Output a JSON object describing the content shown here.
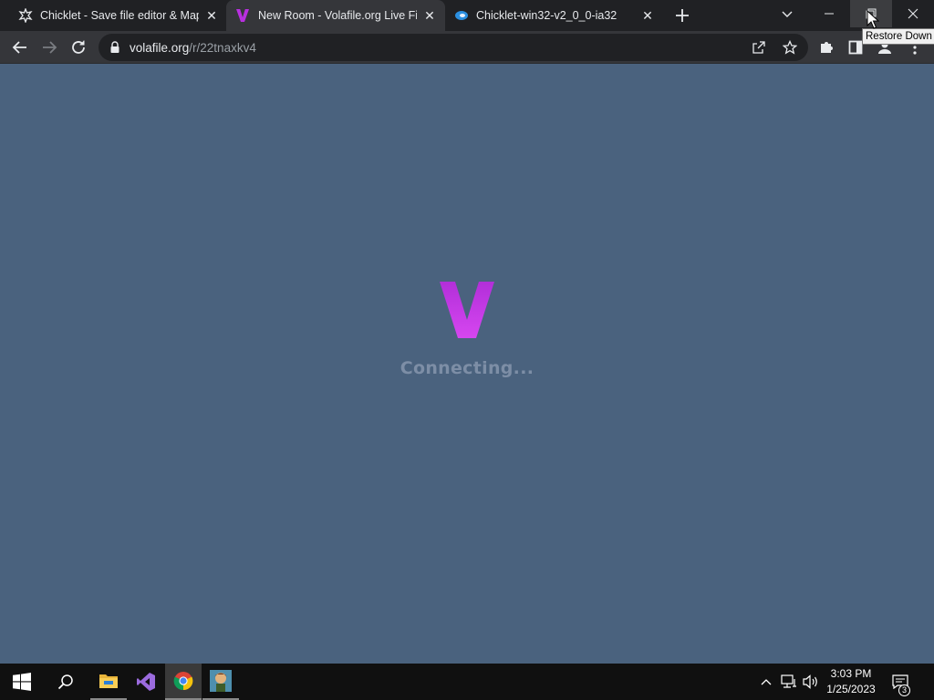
{
  "browser": {
    "tabs": [
      {
        "title": "Chicklet - Save file editor & Map",
        "favicon": "chicklet-icon",
        "active": false
      },
      {
        "title": "New Room - Volafile.org Live File",
        "favicon": "volafile-v-icon",
        "active": true
      },
      {
        "title": "Chicklet-win32-v2_0_0-ia32",
        "favicon": "electron-icon",
        "active": false
      }
    ],
    "new_tab_icon": "plus-icon",
    "window_controls": [
      "tab-search-icon",
      "minimize-icon",
      "maximize-icon",
      "close-icon"
    ],
    "address": {
      "host": "volafile.org",
      "path": "/r/22tnaxkv4"
    },
    "tooltip": "Restore Down"
  },
  "page": {
    "logo_letter": "V",
    "status": "Connecting...",
    "colors": {
      "background": "#4a627e",
      "logo": "#c23de6",
      "status": "#7d8ea6"
    }
  },
  "taskbar": {
    "apps": [
      "windows-start-icon",
      "search-icon",
      "file-explorer-icon",
      "visual-studio-icon",
      "chrome-icon",
      "game-app-icon"
    ],
    "clock": {
      "time": "3:03 PM",
      "date": "1/25/2023"
    },
    "notification_count": "3"
  }
}
